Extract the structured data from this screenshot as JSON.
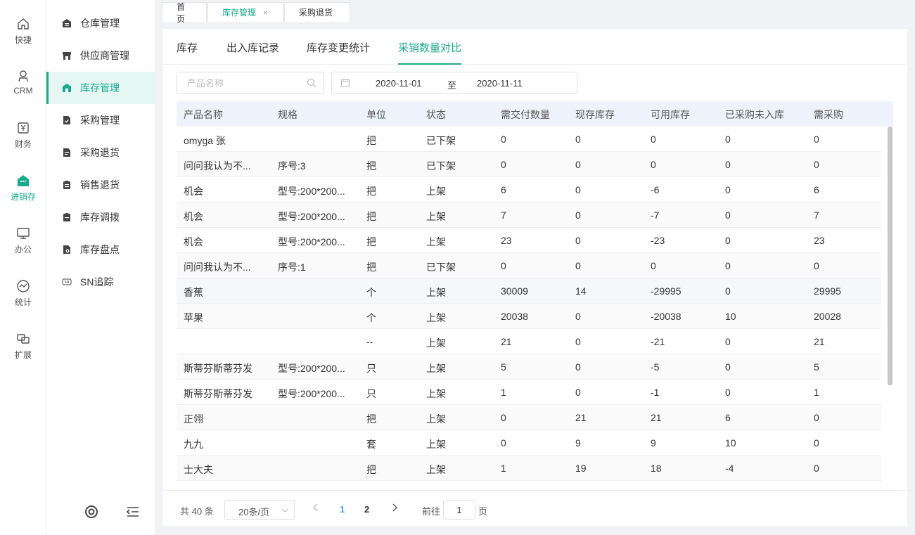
{
  "rail": {
    "items": [
      {
        "label": "快捷",
        "icon": "home-icon"
      },
      {
        "label": "CRM",
        "icon": "person-icon"
      },
      {
        "label": "财务",
        "icon": "finance-icon"
      },
      {
        "label": "进销存",
        "icon": "warehouse-icon"
      },
      {
        "label": "办公",
        "icon": "monitor-icon"
      },
      {
        "label": "统计",
        "icon": "stats-icon"
      },
      {
        "label": "扩展",
        "icon": "extend-icon"
      }
    ]
  },
  "submenu": {
    "items": [
      {
        "label": "仓库管理"
      },
      {
        "label": "供应商管理"
      },
      {
        "label": "库存管理"
      },
      {
        "label": "采购管理"
      },
      {
        "label": "采购退货"
      },
      {
        "label": "销售退货"
      },
      {
        "label": "库存调拨"
      },
      {
        "label": "库存盘点"
      },
      {
        "label": "SN追踪"
      }
    ]
  },
  "page_tabs": [
    {
      "label": "首页"
    },
    {
      "label": "库存管理",
      "close": "×"
    },
    {
      "label": "采购退货"
    }
  ],
  "sub_tabs": [
    {
      "label": "库存"
    },
    {
      "label": "出入库记录"
    },
    {
      "label": "库存变更统计"
    },
    {
      "label": "采销数量对比"
    }
  ],
  "filters": {
    "product_placeholder": "产品名称",
    "date_start": "2020-11-01",
    "date_sep": "至",
    "date_end": "2020-11-11"
  },
  "table": {
    "headers": [
      "产品名称",
      "规格",
      "单位",
      "状态",
      "需交付数量",
      "现存库存",
      "可用库存",
      "已采购未入库",
      "需采购"
    ],
    "rows": [
      [
        "omyga 张",
        "",
        "把",
        "已下架",
        "0",
        "0",
        "0",
        "0",
        "0"
      ],
      [
        "问问我认为不...",
        "序号:3",
        "把",
        "已下架",
        "0",
        "0",
        "0",
        "0",
        "0"
      ],
      [
        "机会",
        "型号:200*200...",
        "把",
        "上架",
        "6",
        "0",
        "-6",
        "0",
        "6"
      ],
      [
        "机会",
        "型号:200*200...",
        "把",
        "上架",
        "7",
        "0",
        "-7",
        "0",
        "7"
      ],
      [
        "机会",
        "型号:200*200...",
        "把",
        "上架",
        "23",
        "0",
        "-23",
        "0",
        "23"
      ],
      [
        "问问我认为不...",
        "序号:1",
        "把",
        "已下架",
        "0",
        "0",
        "0",
        "0",
        "0"
      ],
      [
        "香蕉",
        "",
        "个",
        "上架",
        "30009",
        "14",
        "-29995",
        "0",
        "29995"
      ],
      [
        "苹果",
        "",
        "个",
        "上架",
        "20038",
        "0",
        "-20038",
        "10",
        "20028"
      ],
      [
        "",
        "",
        "--",
        "上架",
        "21",
        "0",
        "-21",
        "0",
        "21"
      ],
      [
        "斯蒂芬斯蒂芬发",
        "型号:200*200...",
        "只",
        "上架",
        "5",
        "0",
        "-5",
        "0",
        "5"
      ],
      [
        "斯蒂芬斯蒂芬发",
        "型号:200*200...",
        "只",
        "上架",
        "1",
        "0",
        "-1",
        "0",
        "1"
      ],
      [
        "正翎",
        "",
        "把",
        "上架",
        "0",
        "21",
        "21",
        "6",
        "0"
      ],
      [
        "九九",
        "",
        "套",
        "上架",
        "0",
        "9",
        "9",
        "10",
        "0"
      ],
      [
        "士大夫",
        "",
        "把",
        "上架",
        "1",
        "19",
        "18",
        "-4",
        "0"
      ]
    ]
  },
  "pagination": {
    "total": "共 40 条",
    "page_size": "20条/页",
    "pages": [
      "1",
      "2"
    ],
    "goto_label": "前往",
    "goto_value": "1",
    "page_unit": "页"
  },
  "colors": {
    "accent": "#1aaa8c",
    "link": "#409eff"
  }
}
